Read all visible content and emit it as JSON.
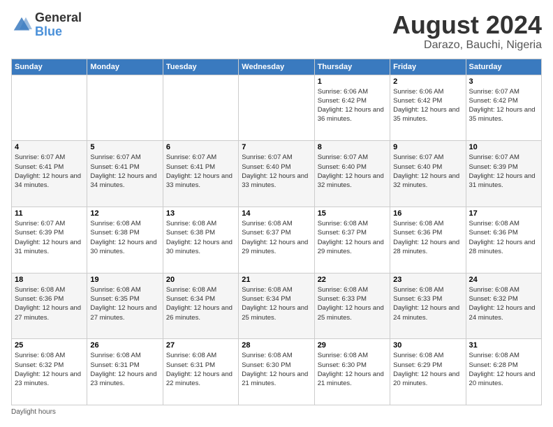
{
  "logo": {
    "line1": "General",
    "line2": "Blue"
  },
  "title": "August 2024",
  "subtitle": "Darazo, Bauchi, Nigeria",
  "footer": "Daylight hours",
  "days_of_week": [
    "Sunday",
    "Monday",
    "Tuesday",
    "Wednesday",
    "Thursday",
    "Friday",
    "Saturday"
  ],
  "weeks": [
    [
      {
        "day": "",
        "info": ""
      },
      {
        "day": "",
        "info": ""
      },
      {
        "day": "",
        "info": ""
      },
      {
        "day": "",
        "info": ""
      },
      {
        "day": "1",
        "info": "Sunrise: 6:06 AM\nSunset: 6:42 PM\nDaylight: 12 hours\nand 36 minutes."
      },
      {
        "day": "2",
        "info": "Sunrise: 6:06 AM\nSunset: 6:42 PM\nDaylight: 12 hours\nand 35 minutes."
      },
      {
        "day": "3",
        "info": "Sunrise: 6:07 AM\nSunset: 6:42 PM\nDaylight: 12 hours\nand 35 minutes."
      }
    ],
    [
      {
        "day": "4",
        "info": "Sunrise: 6:07 AM\nSunset: 6:41 PM\nDaylight: 12 hours\nand 34 minutes."
      },
      {
        "day": "5",
        "info": "Sunrise: 6:07 AM\nSunset: 6:41 PM\nDaylight: 12 hours\nand 34 minutes."
      },
      {
        "day": "6",
        "info": "Sunrise: 6:07 AM\nSunset: 6:41 PM\nDaylight: 12 hours\nand 33 minutes."
      },
      {
        "day": "7",
        "info": "Sunrise: 6:07 AM\nSunset: 6:40 PM\nDaylight: 12 hours\nand 33 minutes."
      },
      {
        "day": "8",
        "info": "Sunrise: 6:07 AM\nSunset: 6:40 PM\nDaylight: 12 hours\nand 32 minutes."
      },
      {
        "day": "9",
        "info": "Sunrise: 6:07 AM\nSunset: 6:40 PM\nDaylight: 12 hours\nand 32 minutes."
      },
      {
        "day": "10",
        "info": "Sunrise: 6:07 AM\nSunset: 6:39 PM\nDaylight: 12 hours\nand 31 minutes."
      }
    ],
    [
      {
        "day": "11",
        "info": "Sunrise: 6:07 AM\nSunset: 6:39 PM\nDaylight: 12 hours\nand 31 minutes."
      },
      {
        "day": "12",
        "info": "Sunrise: 6:08 AM\nSunset: 6:38 PM\nDaylight: 12 hours\nand 30 minutes."
      },
      {
        "day": "13",
        "info": "Sunrise: 6:08 AM\nSunset: 6:38 PM\nDaylight: 12 hours\nand 30 minutes."
      },
      {
        "day": "14",
        "info": "Sunrise: 6:08 AM\nSunset: 6:37 PM\nDaylight: 12 hours\nand 29 minutes."
      },
      {
        "day": "15",
        "info": "Sunrise: 6:08 AM\nSunset: 6:37 PM\nDaylight: 12 hours\nand 29 minutes."
      },
      {
        "day": "16",
        "info": "Sunrise: 6:08 AM\nSunset: 6:36 PM\nDaylight: 12 hours\nand 28 minutes."
      },
      {
        "day": "17",
        "info": "Sunrise: 6:08 AM\nSunset: 6:36 PM\nDaylight: 12 hours\nand 28 minutes."
      }
    ],
    [
      {
        "day": "18",
        "info": "Sunrise: 6:08 AM\nSunset: 6:36 PM\nDaylight: 12 hours\nand 27 minutes."
      },
      {
        "day": "19",
        "info": "Sunrise: 6:08 AM\nSunset: 6:35 PM\nDaylight: 12 hours\nand 27 minutes."
      },
      {
        "day": "20",
        "info": "Sunrise: 6:08 AM\nSunset: 6:34 PM\nDaylight: 12 hours\nand 26 minutes."
      },
      {
        "day": "21",
        "info": "Sunrise: 6:08 AM\nSunset: 6:34 PM\nDaylight: 12 hours\nand 25 minutes."
      },
      {
        "day": "22",
        "info": "Sunrise: 6:08 AM\nSunset: 6:33 PM\nDaylight: 12 hours\nand 25 minutes."
      },
      {
        "day": "23",
        "info": "Sunrise: 6:08 AM\nSunset: 6:33 PM\nDaylight: 12 hours\nand 24 minutes."
      },
      {
        "day": "24",
        "info": "Sunrise: 6:08 AM\nSunset: 6:32 PM\nDaylight: 12 hours\nand 24 minutes."
      }
    ],
    [
      {
        "day": "25",
        "info": "Sunrise: 6:08 AM\nSunset: 6:32 PM\nDaylight: 12 hours\nand 23 minutes."
      },
      {
        "day": "26",
        "info": "Sunrise: 6:08 AM\nSunset: 6:31 PM\nDaylight: 12 hours\nand 23 minutes."
      },
      {
        "day": "27",
        "info": "Sunrise: 6:08 AM\nSunset: 6:31 PM\nDaylight: 12 hours\nand 22 minutes."
      },
      {
        "day": "28",
        "info": "Sunrise: 6:08 AM\nSunset: 6:30 PM\nDaylight: 12 hours\nand 21 minutes."
      },
      {
        "day": "29",
        "info": "Sunrise: 6:08 AM\nSunset: 6:30 PM\nDaylight: 12 hours\nand 21 minutes."
      },
      {
        "day": "30",
        "info": "Sunrise: 6:08 AM\nSunset: 6:29 PM\nDaylight: 12 hours\nand 20 minutes."
      },
      {
        "day": "31",
        "info": "Sunrise: 6:08 AM\nSunset: 6:28 PM\nDaylight: 12 hours\nand 20 minutes."
      }
    ]
  ]
}
